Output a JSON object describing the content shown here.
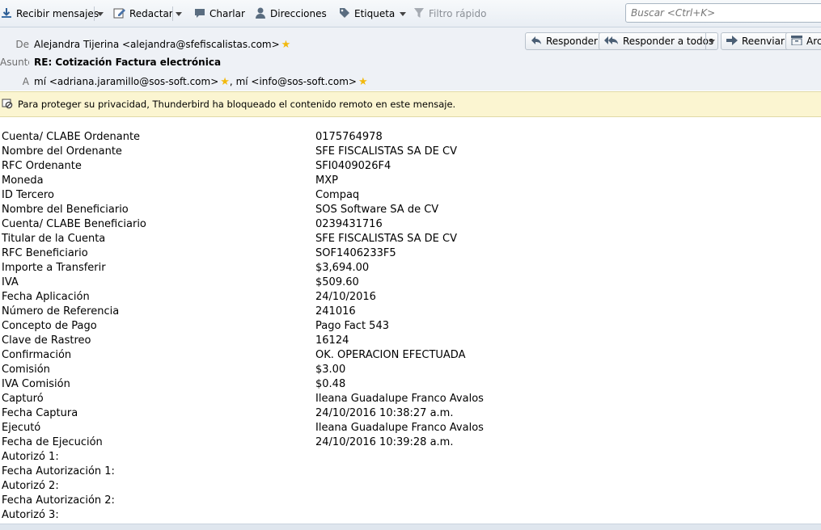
{
  "toolbar": {
    "get_mail": "Recibir mensajes",
    "compose": "Redactar",
    "chat": "Charlar",
    "address_book": "Direcciones",
    "tag": "Etiqueta",
    "quick_filter": "Filtro rápido",
    "search_placeholder": "Buscar <Ctrl+K>"
  },
  "header": {
    "from_label": "De",
    "from_value": "Alejandra Tijerina <alejandra@sfefiscalistas.com>",
    "subject_label": "Asunto",
    "subject_value": "RE: Cotización Factura electrónica",
    "to_label": "A",
    "to_value_1": "mí <adriana.jaramillo@sos-soft.com>",
    "to_sep": ", ",
    "to_value_2": "mí <info@sos-soft.com>",
    "actions": {
      "reply": "Responder",
      "reply_all": "Responder a todos",
      "forward": "Reenviar",
      "archive": "Arc"
    }
  },
  "notice": {
    "text": "Para proteger su privacidad, Thunderbird ha bloqueado el contenido remoto en este mensaje."
  },
  "body_rows": [
    {
      "key": "Cuenta/ CLABE Ordenante",
      "value": "0175764978"
    },
    {
      "key": "Nombre del Ordenante",
      "value": "SFE FISCALISTAS SA DE CV"
    },
    {
      "key": "RFC Ordenante",
      "value": "SFI0409026F4"
    },
    {
      "key": "Moneda",
      "value": "MXP"
    },
    {
      "key": "ID Tercero",
      "value": "Compaq"
    },
    {
      "key": "Nombre del Beneficiario",
      "value": "SOS Software SA de CV"
    },
    {
      "key": "Cuenta/ CLABE Beneficiario",
      "value": "0239431716"
    },
    {
      "key": "Titular de la Cuenta",
      "value": "SFE FISCALISTAS SA DE CV"
    },
    {
      "key": "RFC Beneficiario",
      "value": "SOF1406233F5"
    },
    {
      "key": "Importe a Transferir",
      "value": "$3,694.00"
    },
    {
      "key": "IVA",
      "value": "$509.60"
    },
    {
      "key": "Fecha Aplicación",
      "value": "24/10/2016"
    },
    {
      "key": "Número de Referencia",
      "value": "241016"
    },
    {
      "key": "Concepto de Pago",
      "value": "Pago Fact 543"
    },
    {
      "key": "Clave de Rastreo",
      "value": "16124"
    },
    {
      "key": "Confirmación",
      "value": "OK. OPERACION EFECTUADA"
    },
    {
      "key": "Comisión",
      "value": "$3.00"
    },
    {
      "key": "IVA Comisión",
      "value": "$0.48"
    },
    {
      "key": "Capturó",
      "value": "Ileana Guadalupe Franco Avalos"
    },
    {
      "key": "Fecha Captura",
      "value": "24/10/2016 10:38:27 a.m."
    },
    {
      "key": "Ejecutó",
      "value": "Ileana Guadalupe Franco Avalos"
    },
    {
      "key": "Fecha de Ejecución",
      "value": "24/10/2016 10:39:28 a.m."
    },
    {
      "key": "Autorizó 1:",
      "value": ""
    },
    {
      "key": "Fecha Autorización 1:",
      "value": ""
    },
    {
      "key": "Autorizó 2:",
      "value": ""
    },
    {
      "key": "Fecha Autorización 2:",
      "value": ""
    },
    {
      "key": "Autorizó 3:",
      "value": ""
    }
  ],
  "colors": {
    "star": "#f2b90d",
    "notice_bg": "#fbf5d1",
    "header_bg": "#eef1f6"
  },
  "icons": [
    "download-icon",
    "compose-icon",
    "chat-icon",
    "contacts-icon",
    "tag-icon",
    "filter-icon",
    "reply-icon",
    "reply-all-icon",
    "forward-icon",
    "archive-icon",
    "star-icon",
    "blocked-content-icon"
  ]
}
